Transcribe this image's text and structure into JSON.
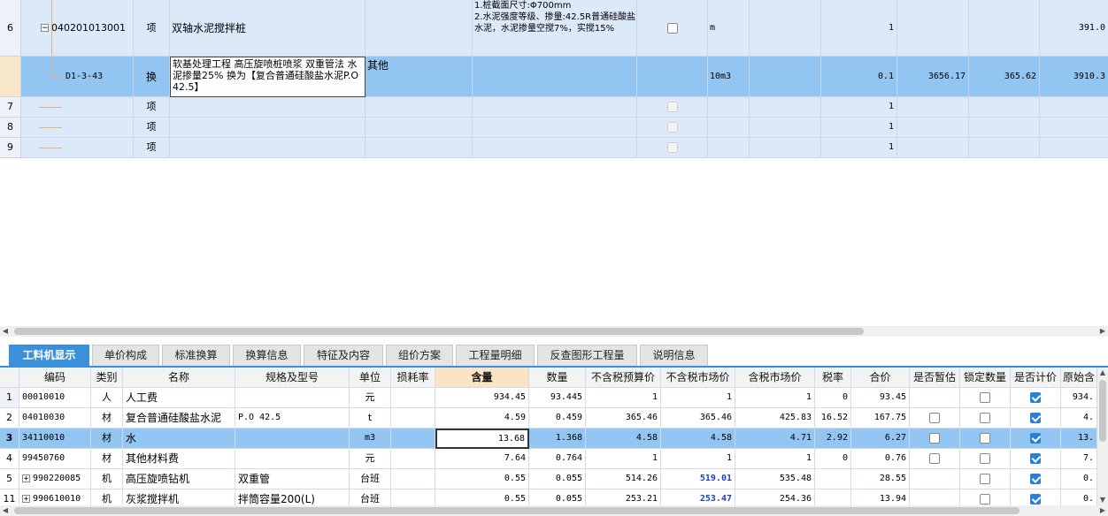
{
  "upper": {
    "rows": [
      {
        "num": "6",
        "code": "040201013001",
        "type": "项",
        "name": "双轴水泥搅拌桩",
        "feature": "1.桩截面尺寸:Φ700mm\n2.水泥强度等级、掺量:42.5R普通硅酸盐水泥，水泥掺量空搅7%，实搅15%",
        "unit": "m",
        "qty": "1",
        "total": "391.0"
      },
      {
        "num": "",
        "code": "D1-3-43",
        "type": "换",
        "name": "软基处理工程 高压旋喷桩喷浆 双重管法 水泥掺量25%  换为【复合普通硅酸盐水泥P.O 42.5】",
        "spec": "其他",
        "unit": "10m3",
        "qty": "0.1",
        "price": "3656.17",
        "sum": "365.62",
        "total": "3910.3"
      },
      {
        "num": "7",
        "type": "项",
        "qty": "1"
      },
      {
        "num": "8",
        "type": "项",
        "qty": "1"
      },
      {
        "num": "9",
        "type": "项",
        "qty": "1"
      }
    ],
    "collapse_glyph": "−"
  },
  "tabs": [
    "工料机显示",
    "单价构成",
    "标准换算",
    "换算信息",
    "特征及内容",
    "组价方案",
    "工程量明细",
    "反查图形工程量",
    "说明信息"
  ],
  "lower": {
    "headers": [
      "编码",
      "类别",
      "名称",
      "规格及型号",
      "单位",
      "损耗率",
      "含量",
      "数量",
      "不含税预算价",
      "不含税市场价",
      "含税市场价",
      "税率",
      "合价",
      "是否暂估",
      "锁定数量",
      "是否计价",
      "原始含"
    ],
    "rows": [
      {
        "num": "1",
        "code": "00010010",
        "cat": "人",
        "name": "人工费",
        "spec": "",
        "unit": "元",
        "content": "934.45",
        "qty": "93.445",
        "budget": "1",
        "market": "1",
        "market_tax": "1",
        "rate": "0",
        "sum": "93.45",
        "orig": "934."
      },
      {
        "num": "2",
        "code": "04010030",
        "cat": "材",
        "name": "复合普通硅酸盐水泥",
        "spec": "P.O 42.5",
        "unit": "t",
        "content": "4.59",
        "qty": "0.459",
        "budget": "365.46",
        "market": "365.46",
        "market_tax": "425.83",
        "rate": "16.52",
        "sum": "167.75",
        "orig": "4."
      },
      {
        "num": "3",
        "code": "34110010",
        "cat": "材",
        "name": "水",
        "spec": "",
        "unit": "m3",
        "content": "13.68",
        "qty": "1.368",
        "budget": "4.58",
        "market": "4.58",
        "market_tax": "4.71",
        "rate": "2.92",
        "sum": "6.27",
        "orig": "13."
      },
      {
        "num": "4",
        "code": "99450760",
        "cat": "材",
        "name": "其他材料费",
        "spec": "",
        "unit": "元",
        "content": "7.64",
        "qty": "0.764",
        "budget": "1",
        "market": "1",
        "market_tax": "1",
        "rate": "0",
        "sum": "0.76",
        "orig": "7."
      },
      {
        "num": "5",
        "code": "990220085",
        "cat": "机",
        "name": "高压旋喷钻机",
        "spec": "双重管",
        "unit": "台班",
        "content": "0.55",
        "qty": "0.055",
        "budget": "514.26",
        "market": "519.01",
        "market_tax": "535.48",
        "rate": "",
        "sum": "28.55",
        "orig": "0."
      },
      {
        "num": "11",
        "code": "990610010",
        "cat": "机",
        "name": "灰浆搅拌机",
        "spec": "拌筒容量200(L)",
        "unit": "台班",
        "content": "0.55",
        "qty": "0.055",
        "budget": "253.21",
        "market": "253.47",
        "market_tax": "254.36",
        "rate": "",
        "sum": "13.94",
        "orig": "0."
      }
    ],
    "plus_glyph": "+"
  },
  "colors": {
    "selected_row": "#93c5f3",
    "accent_tab": "#3c8fd9",
    "content_header": "#fbe3c4",
    "bold_blue": "#1f3fbf"
  }
}
